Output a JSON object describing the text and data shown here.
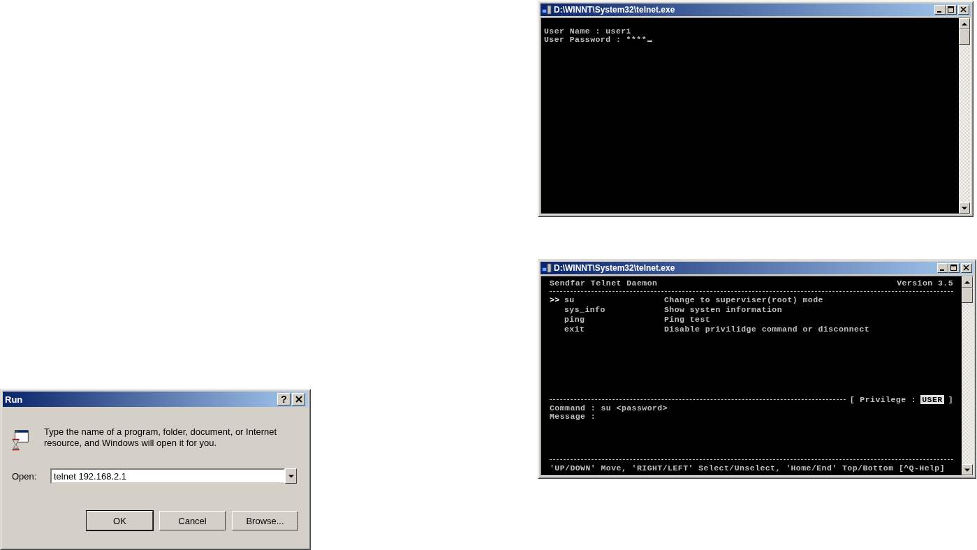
{
  "telnet_windows": [
    {
      "kind": "login",
      "title": "D:\\WINNT\\System32\\telnet.exe",
      "lines": [
        "User Name : user1",
        "User Password : ****"
      ],
      "cursor": true
    },
    {
      "kind": "menu",
      "title": "D:\\WINNT\\System32\\telnet.exe",
      "header_left": "Sendfar Telnet Daemon",
      "header_right": "Version 3.5",
      "cursor_mark": ">>",
      "menu": [
        {
          "command": "su",
          "description": "Change to superviser(root) mode",
          "selected": true
        },
        {
          "command": "sys_info",
          "description": "Show systen information",
          "selected": false
        },
        {
          "command": "ping",
          "description": "Ping test",
          "selected": false
        },
        {
          "command": "exit",
          "description": "Disable privilidge command or disconnect",
          "selected": false
        }
      ],
      "privilege_label": "[ Privilege :",
      "privilege_value": "USER",
      "privilege_close": "]",
      "command_line": "Command : su <password>",
      "message_line": "Message :",
      "help_line": "'UP/DOWN' Move, 'RIGHT/LEFT' Select/Unselect, 'Home/End' Top/Bottom [^Q-Help]"
    }
  ],
  "run_dialog": {
    "title": "Run",
    "help_button": "?",
    "description": "Type the name of a program, folder, document, or Internet resource, and Windows will open it for you.",
    "open_label": "Open:",
    "open_value": "telnet 192.168.2.1",
    "buttons": [
      {
        "label": "OK",
        "default": true
      },
      {
        "label": "Cancel",
        "default": false
      },
      {
        "label": "Browse...",
        "default": false
      }
    ]
  }
}
